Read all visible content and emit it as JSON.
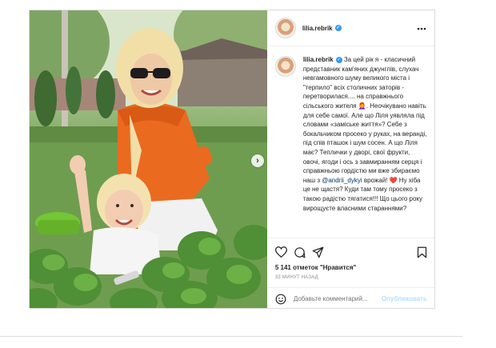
{
  "post": {
    "username": "lilia.rebrik",
    "verified_badge": "✓",
    "more_icon": "more-horizontal-icon",
    "next_arrow": "›",
    "caption": {
      "username": "lilia.rebrik",
      "part1": " За цей рік я - класичний представник кам'яних джунглів, слухач невгамовного шуму великого міста і \"терпило\" всіх столичних заторів - перетворилася.... на справжнього сільського жителя 👩‍🦰. Неочікувано навіть для себе самої. Але що Ліля уявляла під словами «заміське життя»? Себе з бокальчиком просеко у руках, на веранді, під спів пташок і шум сосен. А що Ліля має? Теплички у дворі, свої фрукти, овочі, ягоди і ось з завмиранням серця і справжньою гордістю ми вже збираємо наш з ",
      "mention": "@andrii_dykyi",
      "part2": " врожай! ",
      "heart": "❤️",
      "part3": " Ну хіба це не щастя? Куди там тому просеко з такою радістю тягатися!!! Що цього року вирощуєте власними стараннями?"
    },
    "likes": "5 141 отметок \"Нравится\"",
    "time": "33 МИНУТ НАЗАД",
    "comment_placeholder": "Добавьте комментарий...",
    "post_button": "Опубликовать",
    "icons": [
      "heart-icon",
      "comment-icon",
      "share-icon",
      "bookmark-icon",
      "smile-icon"
    ]
  }
}
